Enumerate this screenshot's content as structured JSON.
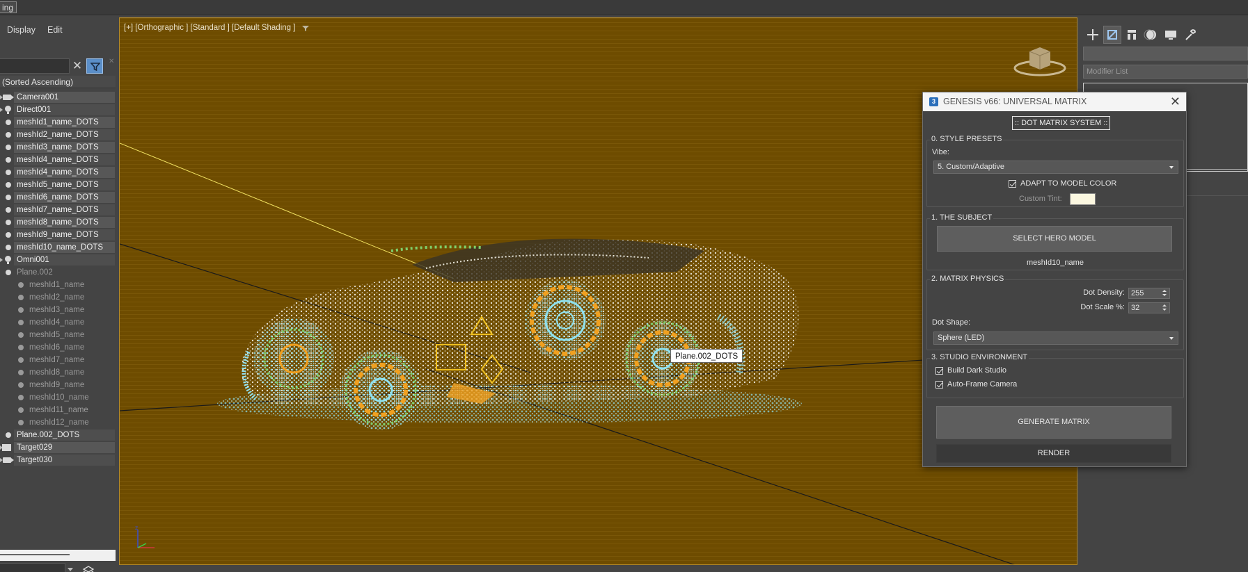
{
  "menubar": {
    "items": [
      "ing"
    ]
  },
  "explorer": {
    "menus": [
      "Display",
      "Edit"
    ],
    "sort_header": "(Sorted Ascending)",
    "rows": [
      {
        "label": "Camera001",
        "icon": "camera-icon",
        "kind": "top"
      },
      {
        "label": "Direct001",
        "icon": "light-icon",
        "kind": "top"
      },
      {
        "label": "meshId1_name_DOTS",
        "icon": "visibility-icon",
        "kind": "top"
      },
      {
        "label": "meshId2_name_DOTS",
        "icon": "visibility-icon",
        "kind": "top"
      },
      {
        "label": "meshId3_name_DOTS",
        "icon": "visibility-icon",
        "kind": "top"
      },
      {
        "label": "meshId4_name_DOTS",
        "icon": "visibility-icon",
        "kind": "top"
      },
      {
        "label": "meshId4_name_DOTS",
        "icon": "visibility-icon",
        "kind": "top"
      },
      {
        "label": "meshId5_name_DOTS",
        "icon": "visibility-icon",
        "kind": "top"
      },
      {
        "label": "meshId6_name_DOTS",
        "icon": "visibility-icon",
        "kind": "top"
      },
      {
        "label": "meshId7_name_DOTS",
        "icon": "visibility-icon",
        "kind": "top"
      },
      {
        "label": "meshId8_name_DOTS",
        "icon": "visibility-icon",
        "kind": "top"
      },
      {
        "label": "meshId9_name_DOTS",
        "icon": "visibility-icon",
        "kind": "top"
      },
      {
        "label": "meshId10_name_DOTS",
        "icon": "visibility-icon",
        "kind": "top"
      },
      {
        "label": "Omni001",
        "icon": "light-icon",
        "kind": "top"
      },
      {
        "label": "Plane.002",
        "icon": "visibility-icon",
        "kind": "dimparent"
      },
      {
        "label": "meshId1_name",
        "icon": "visibility-icon",
        "kind": "child"
      },
      {
        "label": "meshId2_name",
        "icon": "visibility-icon",
        "kind": "child"
      },
      {
        "label": "meshId3_name",
        "icon": "visibility-icon",
        "kind": "child"
      },
      {
        "label": "meshId4_name",
        "icon": "visibility-icon",
        "kind": "child"
      },
      {
        "label": "meshId5_name",
        "icon": "visibility-icon",
        "kind": "child"
      },
      {
        "label": "meshId6_name",
        "icon": "visibility-icon",
        "kind": "child"
      },
      {
        "label": "meshId7_name",
        "icon": "visibility-icon",
        "kind": "child"
      },
      {
        "label": "meshId8_name",
        "icon": "visibility-icon",
        "kind": "child"
      },
      {
        "label": "meshId9_name",
        "icon": "visibility-icon",
        "kind": "child"
      },
      {
        "label": "meshId10_name",
        "icon": "visibility-icon",
        "kind": "child"
      },
      {
        "label": "meshId11_name",
        "icon": "visibility-icon",
        "kind": "child"
      },
      {
        "label": "meshId12_name",
        "icon": "visibility-icon",
        "kind": "child"
      },
      {
        "label": "Plane.002_DOTS",
        "icon": "visibility-icon",
        "kind": "top"
      },
      {
        "label": "Target029",
        "icon": "target-icon",
        "kind": "top"
      },
      {
        "label": "Target030",
        "icon": "camera-icon",
        "kind": "top"
      }
    ]
  },
  "viewport": {
    "label": "[+] [Orthographic ] [Standard ] [Default Shading ]",
    "tooltip": "Plane.002_DOTS",
    "axis_label": "z",
    "background": "#6e4c00"
  },
  "command_panel": {
    "modifier_list": "Modifier List"
  },
  "dialog": {
    "title": "GENESIS v66: UNIVERSAL MATRIX",
    "system_label": ":: DOT MATRIX SYSTEM ::",
    "presets": {
      "title": "0. STYLE PRESETS",
      "vibe_label": "Vibe:",
      "vibe_value": "5. Custom/Adaptive",
      "adapt_label": "ADAPT TO MODEL COLOR",
      "adapt_checked": true,
      "tint_label": "Custom Tint:",
      "tint_color": "#fbf7e0"
    },
    "subject": {
      "title": "1. THE SUBJECT",
      "select_button": "SELECT HERO MODEL",
      "selected_name": "meshId10_name"
    },
    "physics": {
      "title": "2. MATRIX PHYSICS",
      "density_label": "Dot Density:",
      "density_value": "255",
      "scale_label": "Dot Scale %:",
      "scale_value": "32",
      "shape_label": "Dot Shape:",
      "shape_value": "Sphere (LED)"
    },
    "studio": {
      "title": "3. STUDIO ENVIRONMENT",
      "build_label": "Build Dark Studio",
      "build_checked": true,
      "autoframe_label": "Auto-Frame Camera",
      "autoframe_checked": true
    },
    "generate_button": "GENERATE MATRIX",
    "render_button": "RENDER"
  }
}
